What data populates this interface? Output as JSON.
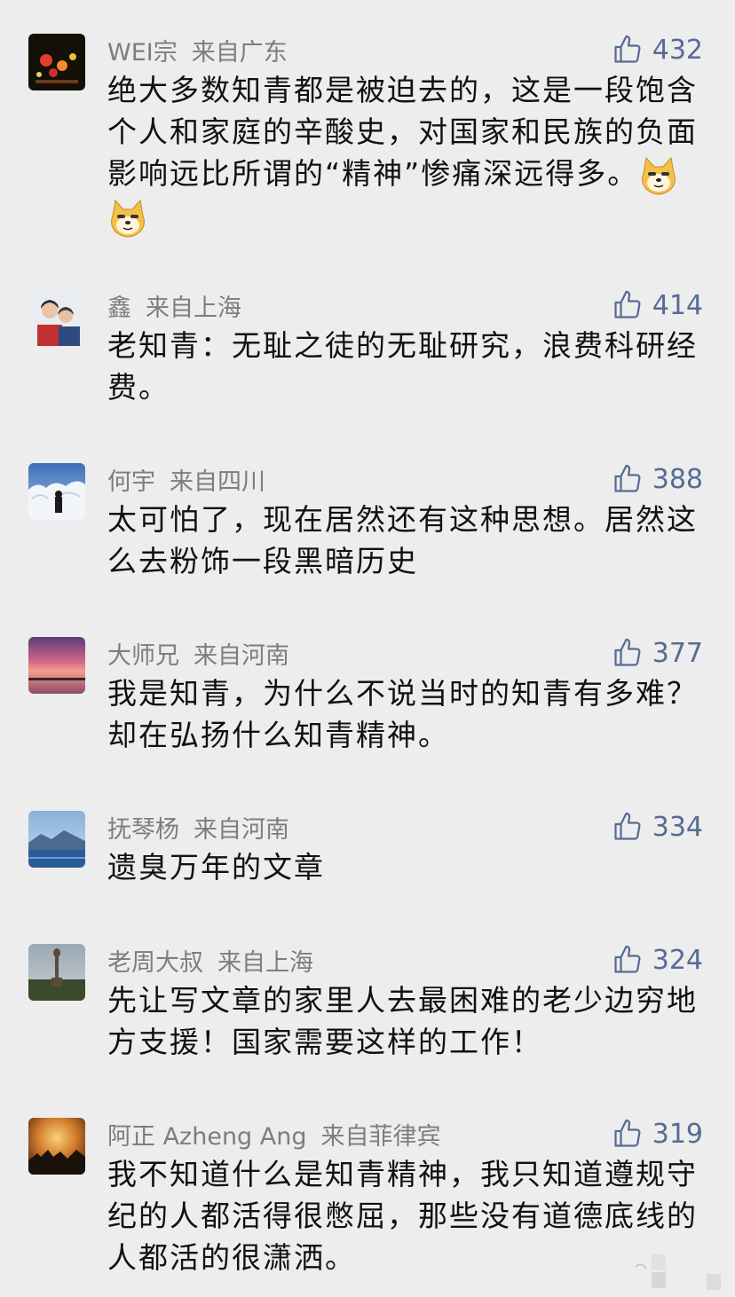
{
  "colors": {
    "background": "#ededed",
    "meta": "#7d7d7d",
    "like": "#576b95",
    "text": "#111111"
  },
  "comments": [
    {
      "name": "WEI宗",
      "location": "来自广东",
      "likes": "432",
      "text": "绝大多数知青都是被迫去的，这是一段饱含个人和家庭的辛酸史，对国家和民族的负面影响远比所谓的“精神”惨痛深远得多。",
      "emoji": [
        "doge-emoji",
        "doge-emoji"
      ]
    },
    {
      "name": "鑫",
      "location": "来自上海",
      "likes": "414",
      "text": "老知青：无耻之徒的无耻研究，浪费科研经费。"
    },
    {
      "name": "何宇",
      "location": "来自四川",
      "likes": "388",
      "text": "太可怕了，现在居然还有这种思想。居然这么去粉饰一段黑暗历史"
    },
    {
      "name": "大师兄",
      "location": "来自河南",
      "likes": "377",
      "text": "我是知青，为什么不说当时的知青有多难？却在弘扬什么知青精神。"
    },
    {
      "name": "抚琴杨",
      "location": "来自河南",
      "likes": "334",
      "text": "遗臭万年的文章"
    },
    {
      "name": "老周大叔",
      "location": "来自上海",
      "likes": "324",
      "text": "先让写文章的家里人去最困难的老少边穷地方支援！国家需要这样的工作！"
    },
    {
      "name": "阿正 Azheng Ang",
      "location": "来自菲律宾",
      "likes": "319",
      "text": "我不知道什么是知青精神，我只知道遵规守纪的人都活得很憋屈，那些没有道德底线的人都活的很潇洒。"
    }
  ]
}
